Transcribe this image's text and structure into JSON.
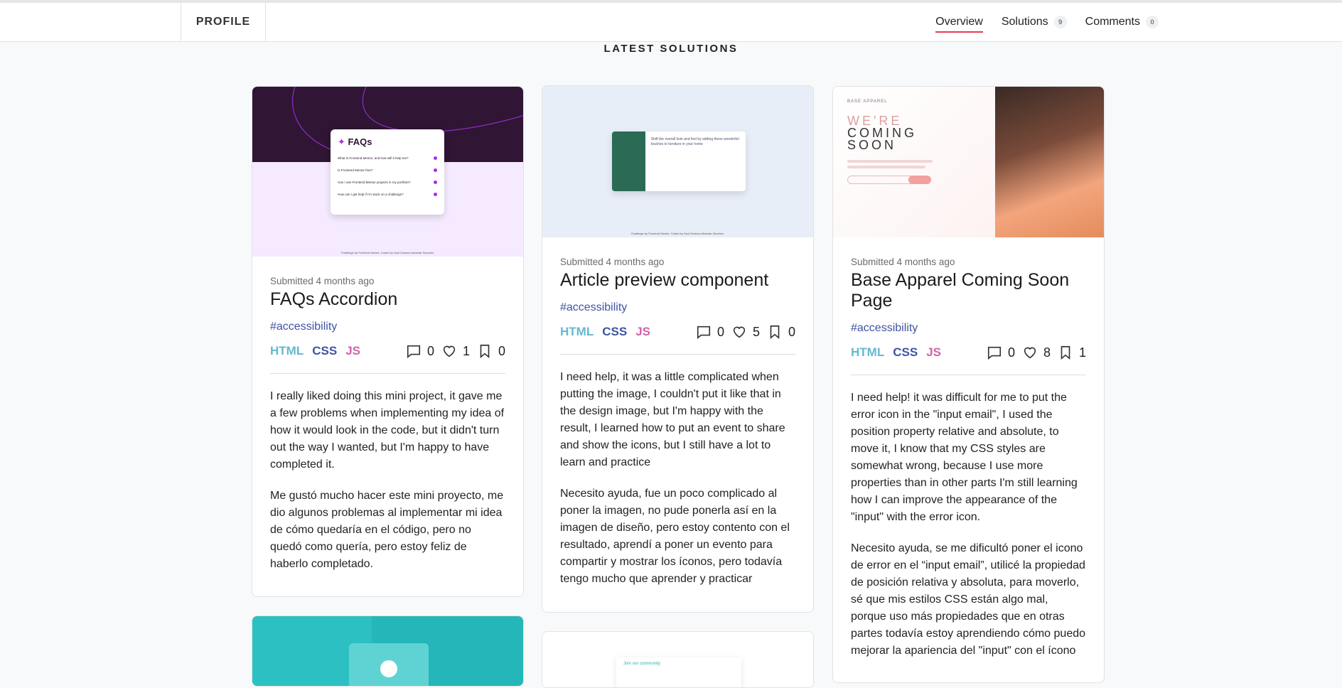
{
  "header": {
    "profile_label": "PROFILE",
    "nav": [
      {
        "label": "Overview",
        "badge": null
      },
      {
        "label": "Solutions",
        "badge": "9"
      },
      {
        "label": "Comments",
        "badge": "0"
      }
    ]
  },
  "section_title": "LATEST SOLUTIONS",
  "cards": [
    {
      "submitted": "Submitted 4 months ago",
      "title": "FAQs Accordion",
      "tag": "#accessibility",
      "langs": [
        "HTML",
        "CSS",
        "JS"
      ],
      "comments": "0",
      "likes": "1",
      "bookmarks": "0",
      "desc": [
        "I really liked doing this mini project, it gave me a few problems when implementing my idea of how it would look in the code, but it didn't turn out the way I wanted, but I'm happy to have completed it.",
        "Me gustó mucho hacer este mini proyecto, me dio algunos problemas al implementar mi idea de cómo quedaría en el código, pero no quedó como quería, pero estoy feliz de haberlo completado."
      ],
      "thumb": {
        "heading": "FAQs",
        "questions": [
          "What is Frontend Mentor, and how will it help me?",
          "Is Frontend Mentor free?",
          "Can I use Frontend Mentor projects in my portfolio?",
          "How can I get help if I'm stuck on a challenge?"
        ],
        "footer": "Challenge by Frontend Mentor. Coded by Saul Gustavo Alcantar Sanchez."
      }
    },
    {
      "submitted": "Submitted 4 months ago",
      "title": "Article preview component",
      "tag": "#accessibility",
      "langs": [
        "HTML",
        "CSS",
        "JS"
      ],
      "comments": "0",
      "likes": "5",
      "bookmarks": "0",
      "desc": [
        "I need help, it was a little complicated when putting the image, I couldn't put it like that in the design image, but I'm happy with the result, I learned how to put an event to share and show the icons, but I still have a lot to learn and practice",
        "Necesito ayuda, fue un poco complicado al poner la imagen, no pude ponerla así en la imagen de diseño, pero estoy contento con el resultado, aprendí a poner un evento para compartir y mostrar los íconos, pero todavía tengo mucho que aprender y practicar"
      ],
      "thumb": {
        "heading": "Shift the overall look and feel by adding these wonderful touches to furniture in your home",
        "footer": "Challenge by Frontend Mentor. Coded by Saul Gustavo Alcantar Sanchez."
      }
    },
    {
      "submitted": "Submitted 4 months ago",
      "title": "Base Apparel Coming Soon Page",
      "tag": "#accessibility",
      "langs": [
        "HTML",
        "CSS",
        "JS"
      ],
      "comments": "0",
      "likes": "8",
      "bookmarks": "1",
      "desc": [
        "I need help! it was difficult for me to put the error icon in the \"input email\", I used the position property relative and absolute, to move it, I know that my CSS styles are somewhat wrong, because I use more properties than in other parts I'm still learning how I can improve the appearance of the \"input\" with the error icon.",
        "Necesito ayuda, se me dificultó poner el icono de error en el “input email”, utilicé la propiedad de posición relativa y absoluta, para moverlo, sé que mis estilos CSS están algo mal, porque uso más propiedades que en otras partes todavía estoy aprendiendo cómo puedo mejorar la apariencia del \"input\" con el ícono"
      ],
      "thumb": {
        "brand": "BASE APPAREL",
        "heading": [
          "WE'RE",
          "COMING",
          "SOON"
        ]
      }
    }
  ],
  "partial_cards": [
    {
      "thumb_text": ""
    },
    {
      "thumb_text": "Join our community"
    }
  ]
}
